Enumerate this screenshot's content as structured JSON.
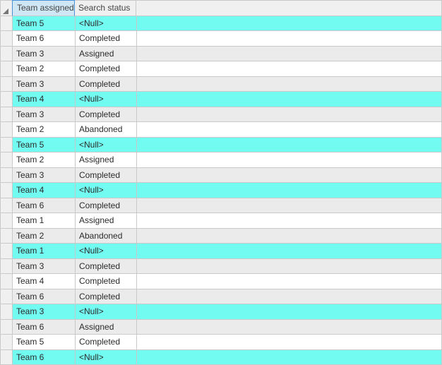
{
  "columns": {
    "team": "Team assigned",
    "status": "Search status"
  },
  "null_label": "<Null>",
  "rows": [
    {
      "team": "Team 5",
      "status": null,
      "hl": true
    },
    {
      "team": "Team 6",
      "status": "Completed",
      "hl": false
    },
    {
      "team": "Team 3",
      "status": "Assigned",
      "hl": false
    },
    {
      "team": "Team 2",
      "status": "Completed",
      "hl": false
    },
    {
      "team": "Team 3",
      "status": "Completed",
      "hl": false
    },
    {
      "team": "Team 4",
      "status": null,
      "hl": true
    },
    {
      "team": "Team 3",
      "status": "Completed",
      "hl": false
    },
    {
      "team": "Team 2",
      "status": "Abandoned",
      "hl": false
    },
    {
      "team": "Team 5",
      "status": null,
      "hl": true
    },
    {
      "team": "Team 2",
      "status": "Assigned",
      "hl": false
    },
    {
      "team": "Team 3",
      "status": "Completed",
      "hl": false
    },
    {
      "team": "Team 4",
      "status": null,
      "hl": true
    },
    {
      "team": "Team 6",
      "status": "Completed",
      "hl": false
    },
    {
      "team": "Team 1",
      "status": "Assigned",
      "hl": false
    },
    {
      "team": "Team 2",
      "status": "Abandoned",
      "hl": false
    },
    {
      "team": "Team 1",
      "status": null,
      "hl": true
    },
    {
      "team": "Team 3",
      "status": "Completed",
      "hl": false
    },
    {
      "team": "Team 4",
      "status": "Completed",
      "hl": false
    },
    {
      "team": "Team 6",
      "status": "Completed",
      "hl": false
    },
    {
      "team": "Team 3",
      "status": null,
      "hl": true
    },
    {
      "team": "Team 6",
      "status": "Assigned",
      "hl": false
    },
    {
      "team": "Team 5",
      "status": "Completed",
      "hl": false
    },
    {
      "team": "Team 6",
      "status": null,
      "hl": true
    }
  ]
}
